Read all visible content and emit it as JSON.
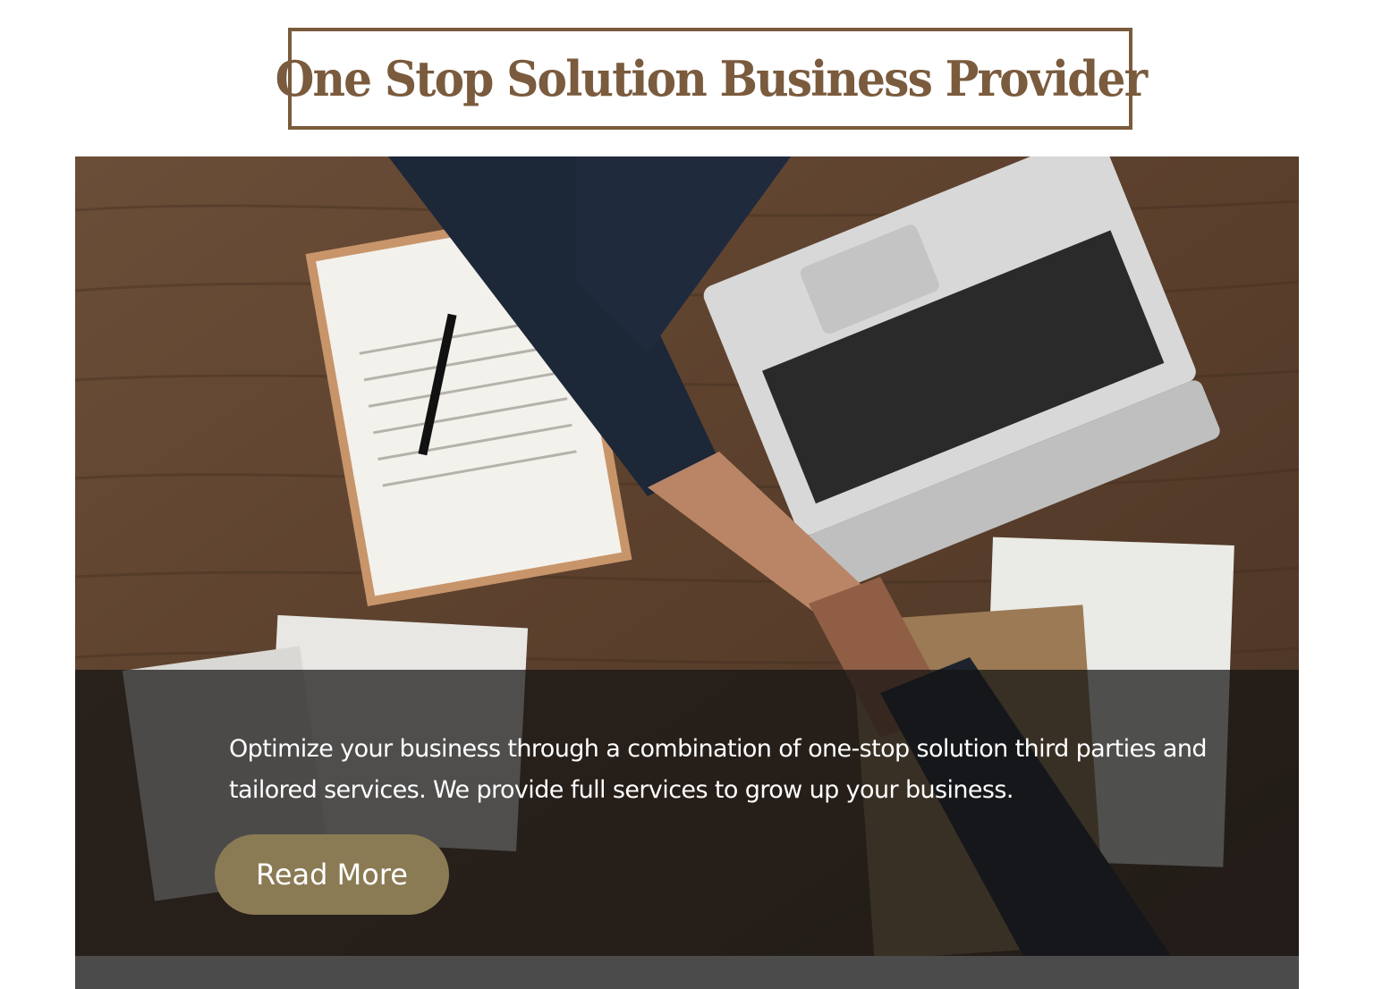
{
  "header": {
    "title": "One Stop Solution Business Provider"
  },
  "hero": {
    "image": "business-handshake-photo",
    "description": "Optimize your business through a combination of one-stop solution third parties and tailored services. We provide full services to grow up your business.",
    "read_more_label": "Read More"
  },
  "colors": {
    "brand": "#7a5b3d",
    "button": "#8b7b55",
    "overlay": "#141414",
    "text_light": "#ffffff"
  }
}
